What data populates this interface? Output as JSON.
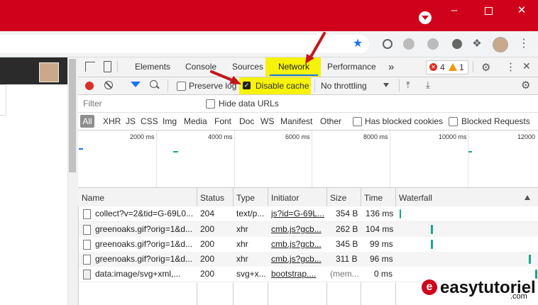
{
  "devtools": {
    "tabs": [
      "Elements",
      "Console",
      "Sources",
      "Network",
      "Performance"
    ],
    "more_tabs": "»",
    "errors_count": "4",
    "warnings_count": "1",
    "preserve_log": "Preserve log",
    "disable_cache": "Disable cache",
    "throttling": "No throttling",
    "filter_placeholder": "Filter",
    "hide_data_urls": "Hide data URLs",
    "type_filters": [
      "All",
      "XHR",
      "JS",
      "CSS",
      "Img",
      "Media",
      "Font",
      "Doc",
      "WS",
      "Manifest",
      "Other"
    ],
    "has_blocked_cookies": "Has blocked cookies",
    "blocked_requests": "Blocked Requests",
    "timeline_ticks": [
      "2000 ms",
      "4000 ms",
      "6000 ms",
      "8000 ms",
      "10000 ms",
      "12000"
    ],
    "columns": [
      "Name",
      "Status",
      "Type",
      "Initiator",
      "Size",
      "Time",
      "Waterfall"
    ],
    "rows": [
      {
        "name": "collect?v=2&tid=G-69L0...",
        "status": "204",
        "type": "text/p...",
        "initiator": "js?id=G-69L...",
        "size": "354 B",
        "time": "136 ms"
      },
      {
        "name": "greenoaks.gif?orig=1&d...",
        "status": "200",
        "type": "xhr",
        "initiator": "cmb.js?gcb...",
        "size": "262 B",
        "time": "104 ms"
      },
      {
        "name": "greenoaks.gif?orig=1&d...",
        "status": "200",
        "type": "xhr",
        "initiator": "cmb.js?gcb...",
        "size": "345 B",
        "time": "99 ms"
      },
      {
        "name": "greenoaks.gif?orig=1&d...",
        "status": "200",
        "type": "xhr",
        "initiator": "cmb.js?gcb...",
        "size": "311 B",
        "time": "96 ms"
      },
      {
        "name": "data:image/svg+xml,...",
        "status": "200",
        "type": "svg+x...",
        "initiator": "bootstrap....",
        "size": "(mem...",
        "time": "0 ms"
      }
    ]
  },
  "watermark": {
    "letter": "e",
    "text": "easytutoriel",
    "suffix": ".com"
  },
  "colors": {
    "titlebar": "#d0021b",
    "network_highlight": "#f6f20a",
    "arrow": "#c4171c"
  }
}
